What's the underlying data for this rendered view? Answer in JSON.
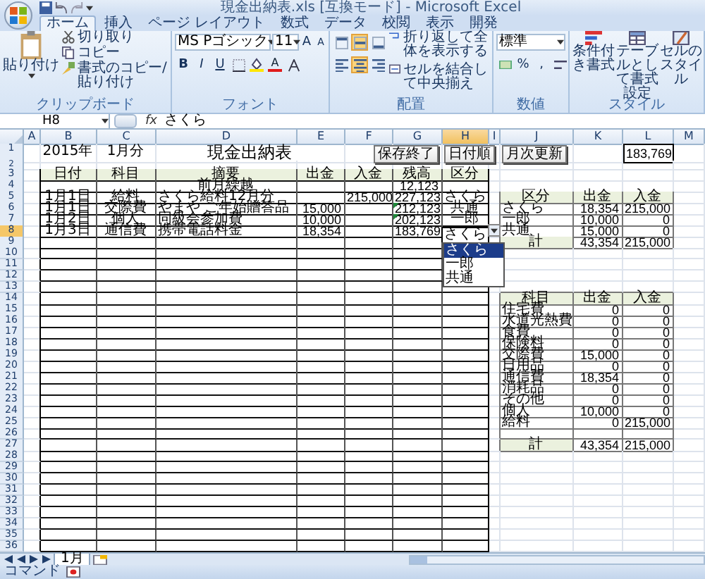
{
  "title": "現金出納表.xls [互換モード] - Microsoft Excel",
  "menu_tabs": [
    {
      "label": "ホーム",
      "selected": true
    },
    {
      "label": "挿入",
      "selected": false
    },
    {
      "label": "ページ レイアウト",
      "selected": false
    },
    {
      "label": "数式",
      "selected": false
    },
    {
      "label": "データ",
      "selected": false
    },
    {
      "label": "校閲",
      "selected": false
    },
    {
      "label": "表示",
      "selected": false
    },
    {
      "label": "開発",
      "selected": false
    }
  ],
  "ribbon": {
    "clipboard": {
      "label": "クリップボード",
      "paste": "貼り付け",
      "items": [
        "切り取り",
        "コピー",
        "書式のコピー/貼り付け"
      ]
    },
    "font": {
      "label": "フォント",
      "name": "MS Pゴシック",
      "size": "11",
      "grow": "A",
      "shrink": "A",
      "bold": "B",
      "italic": "I",
      "underline": "U",
      "color_letter": "A"
    },
    "alignment": {
      "label": "配置",
      "wrap": "折り返して全体を表示する",
      "merge": "セルを結合して中央揃え",
      "align_buttons": [
        {
          "selected": false
        },
        {
          "selected": true
        },
        {
          "selected": false
        },
        {
          "selected": false
        },
        {
          "selected": true
        },
        {
          "selected": false
        }
      ]
    },
    "number": {
      "label": "数値",
      "format": "標準",
      "percent": "%",
      "comma": ","
    },
    "styles": {
      "label": "スタイル",
      "buttons": [
        "条件付き書式",
        "テーブルとして書式設定",
        "セルのスタイル"
      ]
    }
  },
  "formula_bar": {
    "name_box": "H8",
    "function_symbol": "fx",
    "content": "さくら"
  },
  "columns": [
    {
      "label": "A",
      "selected": false
    },
    {
      "label": "B",
      "selected": false
    },
    {
      "label": "C",
      "selected": false
    },
    {
      "label": "D",
      "selected": false
    },
    {
      "label": "E",
      "selected": false
    },
    {
      "label": "F",
      "selected": false
    },
    {
      "label": "G",
      "selected": false
    },
    {
      "label": "H",
      "selected": true
    },
    {
      "label": "I",
      "selected": false
    },
    {
      "label": "J",
      "selected": false
    },
    {
      "label": "K",
      "selected": false
    },
    {
      "label": "L",
      "selected": false
    },
    {
      "label": "M",
      "selected": false
    }
  ],
  "rows": [
    {
      "number": "1",
      "selected": false,
      "cells": {
        "B": {
          "text": "2015年",
          "kind": "center"
        },
        "C": {
          "text": "1月分",
          "kind": "center"
        },
        "D": {
          "text": "現金出納表",
          "kind": "title"
        },
        "G": {
          "text": "保存終了",
          "kind": "button"
        },
        "H": {
          "text": "日付順",
          "kind": "button"
        },
        "J": {
          "text": "月次更新",
          "kind": "button"
        },
        "L": {
          "text": "183,769",
          "kind": "boxed"
        }
      }
    },
    {
      "number": "2",
      "selected": false
    },
    {
      "number": "3",
      "selected": false,
      "cells": {
        "B": {
          "text": "日付",
          "kind": "header"
        },
        "C": {
          "text": "科目",
          "kind": "header"
        },
        "D": {
          "text": "摘要",
          "kind": "header"
        },
        "E": {
          "text": "出金",
          "kind": "header"
        },
        "F": {
          "text": "入金",
          "kind": "header"
        },
        "G": {
          "text": "残高",
          "kind": "header"
        },
        "H": {
          "text": "区分",
          "kind": "header"
        }
      }
    },
    {
      "number": "4",
      "selected": false,
      "cells": {
        "D": {
          "text": "前月繰越",
          "kind": "center"
        },
        "G": {
          "text": "12,123",
          "kind": "number"
        }
      }
    },
    {
      "number": "5",
      "selected": false,
      "cells": {
        "B": {
          "text": "1月1日",
          "kind": "center"
        },
        "C": {
          "text": "給料",
          "kind": "center"
        },
        "D": {
          "text": "さくら給料12月分",
          "kind": "text"
        },
        "F": {
          "text": "215,000",
          "kind": "number"
        },
        "G": {
          "text": "227,123",
          "kind": "number"
        },
        "H": {
          "text": "さくら",
          "kind": "center"
        },
        "J": {
          "text": "区分",
          "kind": "header"
        },
        "K": {
          "text": "出金",
          "kind": "header"
        },
        "L": {
          "text": "入金",
          "kind": "header"
        }
      }
    },
    {
      "number": "6",
      "selected": false,
      "cells": {
        "B": {
          "text": "1月1日",
          "kind": "center"
        },
        "C": {
          "text": "交際費",
          "kind": "center"
        },
        "D": {
          "text": "やまや ご年始贈答品",
          "kind": "text"
        },
        "E": {
          "text": "15,000",
          "kind": "number"
        },
        "G": {
          "text": "212,123",
          "kind": "number",
          "flagged": true
        },
        "H": {
          "text": "共通",
          "kind": "center"
        },
        "J": {
          "text": "さくら",
          "kind": "text"
        },
        "K": {
          "text": "18,354",
          "kind": "number"
        },
        "L": {
          "text": "215,000",
          "kind": "number"
        }
      }
    },
    {
      "number": "7",
      "selected": false,
      "cells": {
        "B": {
          "text": "1月2日",
          "kind": "center"
        },
        "C": {
          "text": "個人",
          "kind": "center"
        },
        "D": {
          "text": "同級会参加費",
          "kind": "text"
        },
        "E": {
          "text": "10,000",
          "kind": "number"
        },
        "G": {
          "text": "202,123",
          "kind": "number",
          "flagged": true
        },
        "H": {
          "text": "一郎",
          "kind": "center"
        },
        "J": {
          "text": "一郎",
          "kind": "text"
        },
        "K": {
          "text": "10,000",
          "kind": "number"
        },
        "L": {
          "text": "0",
          "kind": "number"
        }
      }
    },
    {
      "number": "8",
      "selected": true,
      "cells": {
        "B": {
          "text": "1月3日",
          "kind": "center"
        },
        "C": {
          "text": "通信費",
          "kind": "center"
        },
        "D": {
          "text": "携帯電話料金",
          "kind": "text"
        },
        "E": {
          "text": "18,354",
          "kind": "number"
        },
        "G": {
          "text": "183,769",
          "kind": "number"
        },
        "H": {
          "text": "さくら",
          "kind": "dropdown",
          "active": true
        },
        "J": {
          "text": "共通",
          "kind": "text"
        },
        "K": {
          "text": "15,000",
          "kind": "number"
        },
        "L": {
          "text": "0",
          "kind": "number"
        }
      }
    },
    {
      "number": "9",
      "selected": false,
      "cells": {
        "J": {
          "text": "計",
          "kind": "header"
        },
        "K": {
          "text": "43,354",
          "kind": "number"
        },
        "L": {
          "text": "215,000",
          "kind": "number"
        }
      }
    },
    {
      "number": "10",
      "selected": false
    },
    {
      "number": "11",
      "selected": false
    },
    {
      "number": "12",
      "selected": false
    },
    {
      "number": "13",
      "selected": false
    },
    {
      "number": "14",
      "selected": false,
      "cells": {
        "J": {
          "text": "科目",
          "kind": "header"
        },
        "K": {
          "text": "出金",
          "kind": "header"
        },
        "L": {
          "text": "入金",
          "kind": "header"
        }
      }
    },
    {
      "number": "15",
      "selected": false,
      "cells": {
        "J": {
          "text": "住宅費",
          "kind": "text"
        },
        "K": {
          "text": "0",
          "kind": "number"
        },
        "L": {
          "text": "0",
          "kind": "number"
        }
      }
    },
    {
      "number": "16",
      "selected": false,
      "cells": {
        "J": {
          "text": "水道光熱費",
          "kind": "text"
        },
        "K": {
          "text": "0",
          "kind": "number"
        },
        "L": {
          "text": "0",
          "kind": "number"
        }
      }
    },
    {
      "number": "17",
      "selected": false,
      "cells": {
        "J": {
          "text": "食費",
          "kind": "text"
        },
        "K": {
          "text": "0",
          "kind": "number"
        },
        "L": {
          "text": "0",
          "kind": "number"
        }
      }
    },
    {
      "number": "18",
      "selected": false,
      "cells": {
        "J": {
          "text": "保険料",
          "kind": "text"
        },
        "K": {
          "text": "0",
          "kind": "number"
        },
        "L": {
          "text": "0",
          "kind": "number"
        }
      }
    },
    {
      "number": "19",
      "selected": false,
      "cells": {
        "J": {
          "text": "交際費",
          "kind": "text"
        },
        "K": {
          "text": "15,000",
          "kind": "number"
        },
        "L": {
          "text": "0",
          "kind": "number"
        }
      }
    },
    {
      "number": "20",
      "selected": false,
      "cells": {
        "J": {
          "text": "日用品",
          "kind": "text"
        },
        "K": {
          "text": "0",
          "kind": "number"
        },
        "L": {
          "text": "0",
          "kind": "number"
        }
      }
    },
    {
      "number": "21",
      "selected": false,
      "cells": {
        "J": {
          "text": "通信費",
          "kind": "text"
        },
        "K": {
          "text": "18,354",
          "kind": "number"
        },
        "L": {
          "text": "0",
          "kind": "number"
        }
      }
    },
    {
      "number": "22",
      "selected": false,
      "cells": {
        "J": {
          "text": "消耗品",
          "kind": "text"
        },
        "K": {
          "text": "0",
          "kind": "number"
        },
        "L": {
          "text": "0",
          "kind": "number"
        }
      }
    },
    {
      "number": "23",
      "selected": false,
      "cells": {
        "J": {
          "text": "その他",
          "kind": "text"
        },
        "K": {
          "text": "0",
          "kind": "number"
        },
        "L": {
          "text": "0",
          "kind": "number"
        }
      }
    },
    {
      "number": "24",
      "selected": false,
      "cells": {
        "J": {
          "text": "個人",
          "kind": "text"
        },
        "K": {
          "text": "10,000",
          "kind": "number"
        },
        "L": {
          "text": "0",
          "kind": "number"
        }
      }
    },
    {
      "number": "25",
      "selected": false,
      "cells": {
        "J": {
          "text": "給料",
          "kind": "text"
        },
        "K": {
          "text": "0",
          "kind": "number"
        },
        "L": {
          "text": "215,000",
          "kind": "number"
        }
      }
    },
    {
      "number": "26",
      "selected": false
    },
    {
      "number": "27",
      "selected": false,
      "cells": {
        "J": {
          "text": "計",
          "kind": "header"
        },
        "K": {
          "text": "43,354",
          "kind": "number"
        },
        "L": {
          "text": "215,000",
          "kind": "number"
        }
      }
    },
    {
      "number": "28",
      "selected": false
    },
    {
      "number": "29",
      "selected": false
    },
    {
      "number": "30",
      "selected": false
    },
    {
      "number": "31",
      "selected": false
    },
    {
      "number": "32",
      "selected": false
    },
    {
      "number": "33",
      "selected": false
    },
    {
      "number": "34",
      "selected": false
    },
    {
      "number": "35",
      "selected": false
    },
    {
      "number": "36",
      "selected": false
    }
  ],
  "dropdown": {
    "items": [
      {
        "label": "さくら",
        "selected": true
      },
      {
        "label": "一郎",
        "selected": false
      },
      {
        "label": "共通",
        "selected": false
      }
    ]
  },
  "sheet_tabs": [
    {
      "label": "1月",
      "selected": true
    }
  ],
  "status": "コマンド"
}
